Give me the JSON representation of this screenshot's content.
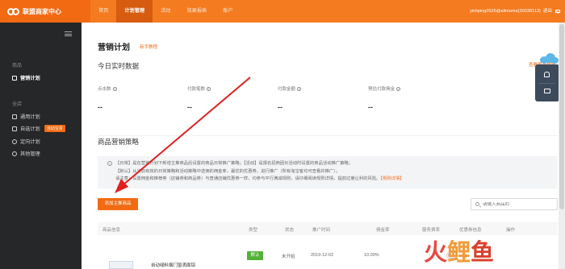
{
  "topbar": {
    "brand": "联盟商家中心",
    "nav": [
      "首页",
      "计划管理",
      "活动",
      "效果报表",
      "账户"
    ],
    "active_nav": "计划管理",
    "user": "yinliping0526@alimama(30038113)",
    "logout": "退出"
  },
  "sidebar": {
    "section_product": "商品",
    "item_marketing_plan": "营销计划",
    "section_store": "全店",
    "item_general_plan": "通用计划",
    "item_self_plan": "自选计划",
    "self_plan_badge": "活动宝贵",
    "item_directed_plan": "定向计划",
    "item_other": "其他管理"
  },
  "main": {
    "page_title": "营销计划",
    "tutorial_link": "新手教程",
    "realtime_title": "今日实时数据",
    "more_link": "查看更多数据",
    "metrics": [
      {
        "label": "点击数",
        "value": "--"
      },
      {
        "label": "付款笔数",
        "value": "--"
      },
      {
        "label": "付款金额",
        "value": "--"
      },
      {
        "label": "预估付款佣金",
        "value": "--"
      }
    ],
    "strategy_title": "商品营销策略",
    "notice": {
      "line1": "【日常】是在营销计划下新增主推商品后设置的商品日常推广策略；【活动】是报名招商团长活动时设置的商品活动推广策略；",
      "line2": "【默认】从当前有效的日常策略和活动策略中选佣的佣金率，最优的优惠券，进行推广（所有淘宝客均可查看并推广）。",
      "line3": "请注意：设置佣金和推荐券（店铺券和商品券）与普通店铺优惠券一样，均参与平行满减规则，请仔细阅读规则详情，提前过度让利的风险。",
      "rule_link": "【规则详情】"
    },
    "add_button": "添加主推商品",
    "search_placeholder": "请输入商品ID",
    "table": {
      "headers": [
        "商品信息",
        "类型",
        "状态",
        "推广时间",
        "佣金率",
        "服务费率",
        "优惠券信息",
        "操作"
      ],
      "rows": [
        {
          "name": "自动绿料烟门窗滴面铝",
          "type": "默认",
          "status": "未开始",
          "date": "2019-12-02",
          "commission": "10.00%",
          "service_fee": "-",
          "coupon": "无"
        }
      ]
    }
  },
  "watermark": {
    "part1": "火",
    "part2": "鲤",
    "part3": "鱼"
  },
  "colors": {
    "brand": "#f47b20",
    "sidebar": "#262728",
    "accent": "#f26a12",
    "tag_green": "#52b236"
  }
}
